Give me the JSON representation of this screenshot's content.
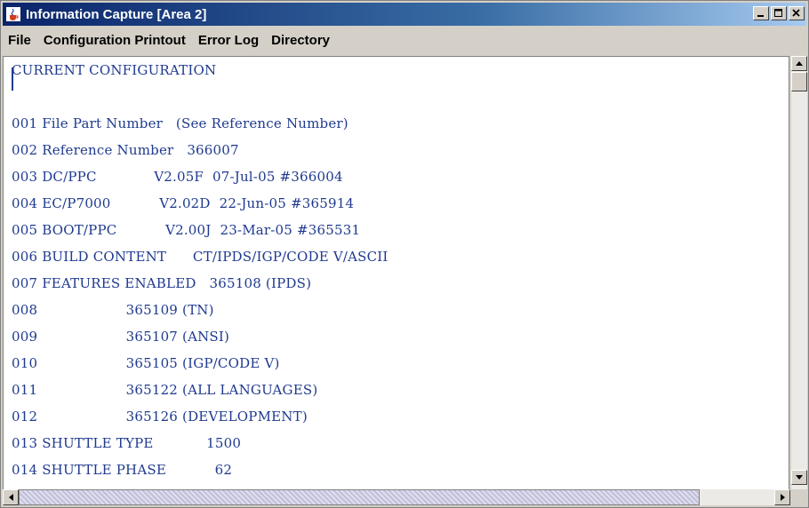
{
  "window": {
    "title": "Information Capture [Area 2]",
    "icon": "java-cup-icon"
  },
  "menu": {
    "items": [
      "File",
      "Configuration Printout",
      "Error Log",
      "Directory"
    ]
  },
  "content": {
    "lines": [
      "CURRENT CONFIGURATION",
      "",
      "001 File Part Number   (See Reference Number)",
      "002 Reference Number   366007",
      "003 DC/PPC             V2.05F  07-Jul-05 #366004",
      "004 EC/P7000           V2.02D  22-Jun-05 #365914",
      "005 BOOT/PPC           V2.00J  23-Mar-05 #365531",
      "006 BUILD CONTENT      CT/IPDS/IGP/CODE V/ASCII",
      "007 FEATURES ENABLED   365108 (IPDS)",
      "008                    365109 (TN)",
      "009                    365107 (ANSI)",
      "010                    365105 (IGP/CODE V)",
      "011                    365122 (ALL LANGUAGES)",
      "012                    365126 (DEVELOPMENT)",
      "013 SHUTTLE TYPE            1500",
      "014 SHUTTLE PHASE           62",
      "015 FLASH                   8 MB"
    ]
  },
  "colors": {
    "text": "#1f3a8f",
    "titlebar": "#0a246a"
  }
}
